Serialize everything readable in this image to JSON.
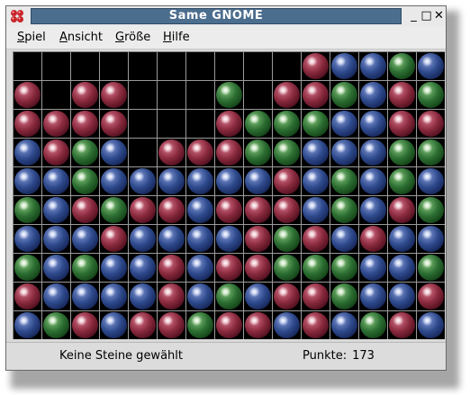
{
  "window": {
    "title": "Same GNOME",
    "controls": {
      "minimize": "_",
      "maximize": "□",
      "close": "✕"
    }
  },
  "menu": {
    "items": [
      {
        "accel": "S",
        "rest": "piel"
      },
      {
        "accel": "A",
        "rest": "nsicht"
      },
      {
        "accel": "G",
        "rest": "röße"
      },
      {
        "accel": "H",
        "rest": "ilfe"
      }
    ]
  },
  "board": {
    "columns": 15,
    "rows": 10,
    "colors": {
      "r": "#8a2a3e",
      "b": "#2e4a8c",
      "g": "#2c6e32",
      "empty": "#000000"
    },
    "grid": [
      "..........rbbgb",
      "r.rr...g.rrgbrg",
      "rrrr...rgggbbrr",
      "brgb.rrrggbbbgg",
      "bbgbbbbbbrbgbgb",
      "gbrgrrbrrrbgbrg",
      "bbbrbbbbrgrbrbb",
      "gbgbbrbrrgggbbg",
      "rbbbbrbgbrrgbbr",
      "bgrbrrgrrbrbgrb"
    ]
  },
  "status": {
    "selection": "Keine Steine gewählt",
    "score_label": "Punkte:",
    "score_value": "173"
  }
}
